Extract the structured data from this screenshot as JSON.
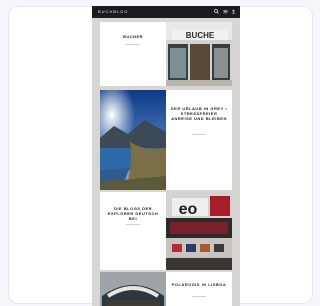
{
  "header": {
    "logo_text": "BUCHBLOG",
    "icons": [
      "search-icon",
      "menu-icon",
      "user-icon"
    ]
  },
  "posts": [
    {
      "title": "BUCHER",
      "meta": "",
      "excerpt": "",
      "read_more": "",
      "image": "bookshop-storefront-image"
    },
    {
      "title": "DER URLAUB IN GREY • STRESSFREIER ANREISE UND BLEIBEN",
      "meta": "",
      "excerpt": "",
      "read_more": "",
      "image": "lake-mountain-image"
    },
    {
      "title": "DIE BLOGS DER EXPLORER DEUTSCH BEI",
      "meta": "",
      "excerpt": "",
      "read_more": "",
      "image": "shop-window-image"
    },
    {
      "title": "POLAROIDS IN LISBOA",
      "meta": "",
      "excerpt": "",
      "read_more": "",
      "image": "cafe-sign-image"
    }
  ],
  "colors": {
    "topbar": "#1c1c1c",
    "page_bg": "#d8d6d3",
    "card_bg": "#ffffff"
  }
}
